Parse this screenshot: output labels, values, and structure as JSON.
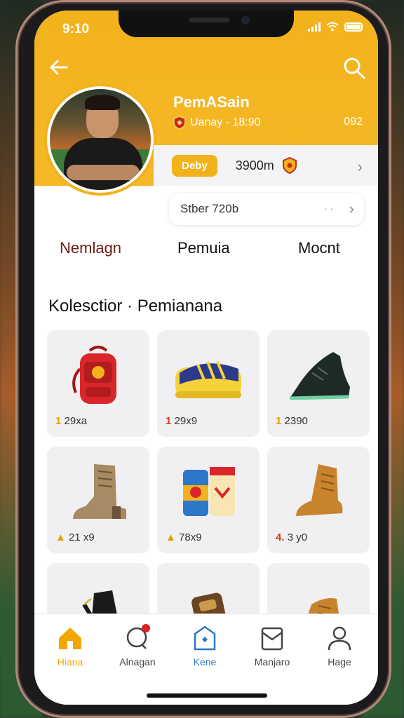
{
  "status": {
    "time": "9:10"
  },
  "profile": {
    "name": "PemASain",
    "meta": "Uanay - 18:90",
    "count": "092"
  },
  "stats": {
    "pill": "Deby",
    "value": "3900m"
  },
  "slider": {
    "label": "Stber 720b",
    "dots": "· ·"
  },
  "tabs": [
    {
      "label": "Nemlagn",
      "active": true
    },
    {
      "label": "Pemuia",
      "active": false
    },
    {
      "label": "Mocnt",
      "active": false
    }
  ],
  "section": {
    "title": "Kolesctior · Pemianana"
  },
  "items": [
    {
      "name": "red-backpack",
      "mark": "1",
      "price": "29xa"
    },
    {
      "name": "yellow-shoe",
      "mark": "1",
      "price": "29x9"
    },
    {
      "name": "black-cleat",
      "mark": "1",
      "price": "2390"
    },
    {
      "name": "tan-boot",
      "mark": "▲",
      "price": "21 x9"
    },
    {
      "name": "soda-cans",
      "mark": "▲",
      "price": "78x9"
    },
    {
      "name": "brown-boot",
      "mark": "4.",
      "price": "3 y0"
    },
    {
      "name": "black-glove",
      "mark": "",
      "price": ""
    },
    {
      "name": "leather-case",
      "mark": "",
      "price": ""
    },
    {
      "name": "brown-shoe",
      "mark": "",
      "price": ""
    }
  ],
  "nav": [
    {
      "label": "Hiana",
      "icon": "home-icon",
      "active": true
    },
    {
      "label": "Alnagan",
      "icon": "chat-icon",
      "active": false
    },
    {
      "label": "Kene",
      "icon": "bag-icon",
      "active": false
    },
    {
      "label": "Manjaro",
      "icon": "document-icon",
      "active": false
    },
    {
      "label": "Hage",
      "icon": "user-icon",
      "active": false
    }
  ],
  "colors": {
    "accent": "#f2b21c",
    "tab_active": "#6b1f12",
    "nav_active": "#f2a700"
  }
}
